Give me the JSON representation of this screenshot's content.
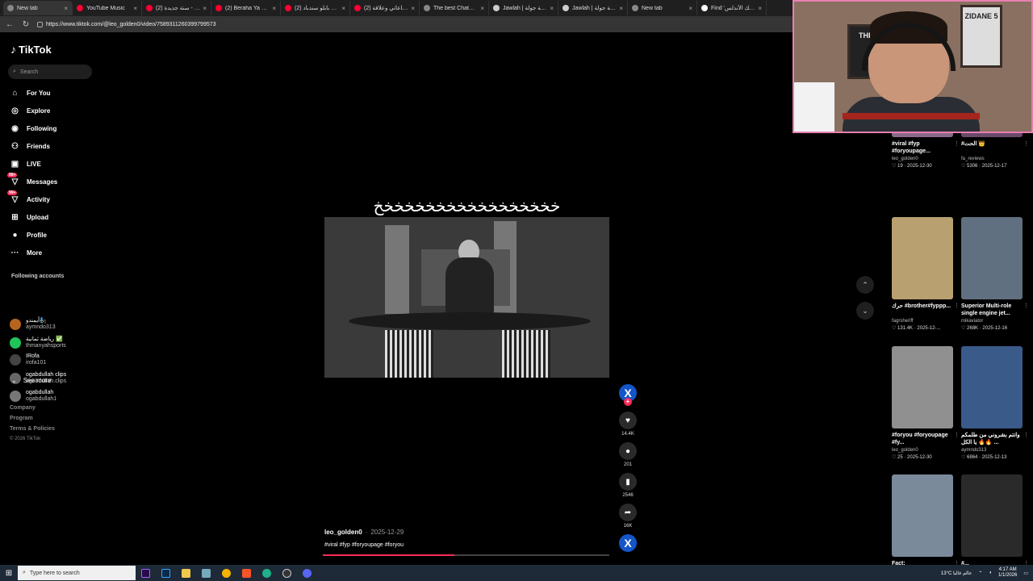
{
  "browser": {
    "tabs": [
      {
        "title": "New tab",
        "color": "#888888"
      },
      {
        "title": "YouTube Music",
        "color": "#ff0033"
      },
      {
        "title": "سنة جديدة (2) - YouTube",
        "color": "#ff0033"
      },
      {
        "title": "(2) Beraha Ya Sheekha",
        "color": "#ff0033"
      },
      {
        "title": "(2) عيون بابلو سندباد",
        "color": "#ff0033"
      },
      {
        "title": "(2) ولدت ساعاتي وعلاقة",
        "color": "#ff0033"
      },
      {
        "title": "The best ChatBot and",
        "color": "#888888"
      },
      {
        "title": "Jawlah | منصة جولة",
        "color": "#cccccc"
      },
      {
        "title": "Jawlah | منصة جولة",
        "color": "#cccccc"
      },
      {
        "title": "New tab",
        "color": "#888888"
      },
      {
        "title": "Find 'ملك الأندلس' on",
        "color": "#ffffff"
      }
    ],
    "url": "https://www.tiktok.com/@leo_golden0/video/7589311260399799573"
  },
  "sidebar": {
    "logo": "TikTok",
    "search_placeholder": "Search",
    "nav": [
      {
        "label": "For You",
        "icon": "home-icon",
        "glyph": "⌂"
      },
      {
        "label": "Explore",
        "icon": "compass-icon",
        "glyph": "◎"
      },
      {
        "label": "Following",
        "icon": "following-icon",
        "glyph": "◉"
      },
      {
        "label": "Friends",
        "icon": "friends-icon",
        "glyph": "⚇"
      },
      {
        "label": "LIVE",
        "icon": "live-icon",
        "glyph": "▣"
      },
      {
        "label": "Messages",
        "icon": "messages-icon",
        "glyph": "▽",
        "badge": "99+"
      },
      {
        "label": "Activity",
        "icon": "activity-icon",
        "glyph": "▽",
        "badge": "99+"
      },
      {
        "label": "Upload",
        "icon": "upload-icon",
        "glyph": "⊞"
      },
      {
        "label": "Profile",
        "icon": "profile-icon",
        "glyph": "●"
      },
      {
        "label": "More",
        "icon": "more-icon",
        "glyph": "···"
      }
    ],
    "following_title": "Following accounts",
    "accounts": [
      {
        "name": "أيمندو🧞",
        "handle": "aymndo313",
        "color": "#b5651d"
      },
      {
        "name": "رياضة ثمانية ✅",
        "handle": "thmanyahsports",
        "color": "#21c45a"
      },
      {
        "name": "IRofa",
        "handle": "irofa101",
        "color": "#444444"
      },
      {
        "name": "ogabdullah clips",
        "handle": "ogabdullah.clips",
        "color": "#666666"
      },
      {
        "name": "ogabdullah",
        "handle": "ogabdullah1",
        "color": "#777777"
      }
    ],
    "see_more": "See more",
    "footer": [
      "Company",
      "Program",
      "Terms & Policies"
    ],
    "copyright": "© 2026 TikTok"
  },
  "video": {
    "overlay_text": "خخخخخخخخخخخخخخخخخخ",
    "author": "leo_golden0",
    "date": "2025-12-29",
    "hashtags": "#viral #fyp #foryoupage #foryou",
    "progress": 0.46,
    "likes": "14.4K",
    "comments": "201",
    "saves": "2546",
    "shares": "16K",
    "avatar_letter": "X"
  },
  "grid": [
    {
      "title": "#viral #fyp #foryoupage...",
      "author": "leo_golden0",
      "meta": "♡ 19 · 2025-12-30",
      "bg": "#8a6a8a"
    },
    {
      "title": "#الحت 👑",
      "author": "fa_reviews",
      "meta": "♡ 5306 · 2025-12-17",
      "bg": "#6a4a6a"
    },
    {
      "title": "حرك #brother#fyppp...",
      "author": "fagrsheriff",
      "meta": "♡ 131.4K · 2025-12-...",
      "bg": "#b8a070"
    },
    {
      "title": "Superior Multi-role single engine jet...",
      "author": "mikaviator",
      "meta": "♡ 268K · 2025-12-16",
      "bg": "#607080"
    },
    {
      "title": "#foryou #foryoupage #fy...",
      "author": "leo_golden0",
      "meta": "♡ 25 · 2025-12-30",
      "bg": "#909090"
    },
    {
      "title": "وانتم بشروني من طلمكم 🔥🔥 يا الكل ...",
      "author": "aymndo313",
      "meta": "♡ 6864 · 2025-12-13",
      "bg": "#3a5a8a"
    },
    {
      "title": "Fact:",
      "author": "",
      "meta": "",
      "bg": "#7a8a9a"
    },
    {
      "title": "#...",
      "author": "",
      "meta": "",
      "bg": "#2a2a2a"
    }
  ],
  "webcam": {
    "poster_left": "THE",
    "poster_right": "ZIDANE 5"
  },
  "taskbar": {
    "search_placeholder": "Type here to search",
    "weather": "13°C عالم غالبا",
    "time": "4:17 AM",
    "date": "1/1/2026"
  }
}
